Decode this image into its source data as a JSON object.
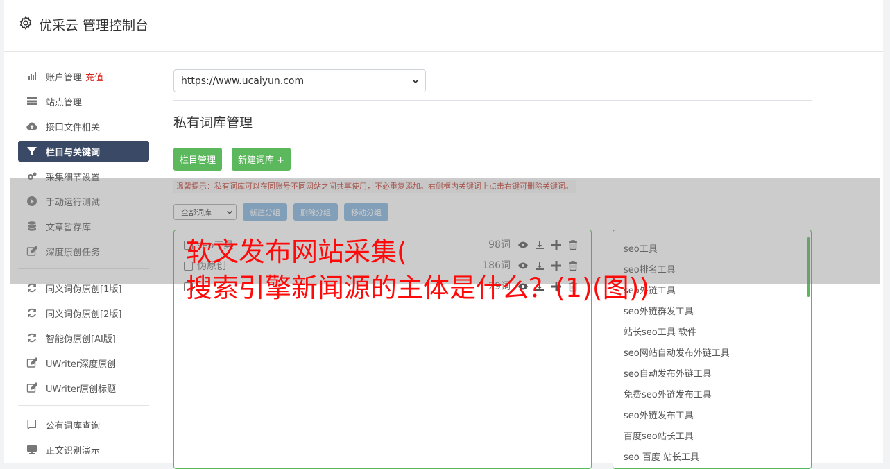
{
  "header": {
    "title": "优采云 管理控制台"
  },
  "sidebar": {
    "items": [
      {
        "label": "账户管理",
        "badge": "充值",
        "icon": "bar-chart-icon"
      },
      {
        "label": "站点管理",
        "icon": "server-icon"
      },
      {
        "label": "接口文件相关",
        "icon": "cloud-upload-icon"
      },
      {
        "label": "栏目与关键词",
        "icon": "filter-icon",
        "active": true
      },
      {
        "label": "采集细节设置",
        "icon": "gears-icon"
      },
      {
        "label": "手动运行测试",
        "icon": "play-circle-icon"
      },
      {
        "label": "文章暂存库",
        "icon": "database-icon"
      },
      {
        "label": "深度原创任务",
        "icon": "edit-icon"
      }
    ],
    "items2": [
      {
        "label": "同义词伪原创[1版]",
        "icon": "refresh-icon"
      },
      {
        "label": "同义词伪原创[2版]",
        "icon": "refresh-icon"
      },
      {
        "label": "智能伪原创[AI版]",
        "icon": "refresh-icon"
      },
      {
        "label": "UWriter深度原创",
        "icon": "edit-icon"
      },
      {
        "label": "UWriter原创标题",
        "icon": "edit-icon"
      }
    ],
    "items3": [
      {
        "label": "公有词库查询",
        "icon": "book-icon"
      },
      {
        "label": "正文识别演示",
        "icon": "monitor-icon"
      }
    ]
  },
  "main": {
    "site_select": "https://www.ucaiyun.com",
    "section_title": "私有词库管理",
    "btn_category": "栏目管理",
    "btn_new_lib": "新建词库 +",
    "hint": "温馨提示：私有词库可以在同账号不同网站之间共享使用，不必重复添加。右侧框内关键词上点击右键可删除关键词。",
    "lib_filter": "全部词库",
    "btn_new_group": "新建分组",
    "btn_delete_group": "删除分组",
    "btn_move_group": "移动分组",
    "libraries": [
      {
        "name": "seo工具",
        "count": "98词"
      },
      {
        "name": "伪原创",
        "count": "186词"
      },
      {
        "name": "",
        "count": "29词"
      }
    ],
    "keywords": [
      "seo工具",
      "seo排名工具",
      "seo外链工具",
      "seo外链群发工具",
      "站长seo工具 软件",
      "seo网站自动发布外链工具",
      "seo自动发布外链工具",
      "免费seo外链发布工具",
      "seo外链发布工具",
      "百度seo站长工具",
      "seo 百度 站长工具"
    ]
  },
  "overlay": {
    "line1": "软文发布网站采集(",
    "line2": "搜索引擎新闻源的主体是什么？(1)(图))"
  },
  "colors": {
    "accent_green": "#5cb85c",
    "active_nav": "#3a4a66",
    "overlay_text": "#ff0a0a",
    "recharge": "#d9251d"
  }
}
